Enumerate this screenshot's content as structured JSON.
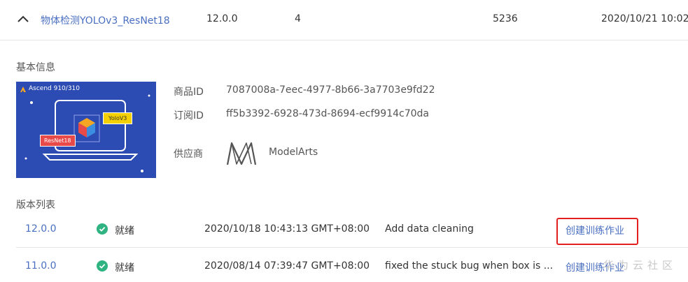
{
  "product_row": {
    "name": "物体检测YOLOv3_ResNet18",
    "version": "12.0.0",
    "count": "4",
    "size": "5236",
    "time": "2020/10/21 10:02:"
  },
  "basic_info": {
    "section_title": "基本信息",
    "image": {
      "chip_label": "Ascend 910/310",
      "tag_yolo": "YoloV3",
      "tag_resnet": "ResNet18"
    },
    "fields": [
      {
        "label": "商品ID",
        "value": "7087008a-7eec-4977-8b66-3a7703e9fd22"
      },
      {
        "label": "订阅ID",
        "value": "ff5b3392-6928-473d-8694-ecf9914c70da"
      },
      {
        "label": "供应商",
        "value": "ModelArts"
      }
    ]
  },
  "versions": {
    "section_title": "版本列表",
    "rows": [
      {
        "version": "12.0.0",
        "status": "就绪",
        "time": "2020/10/18 10:43:13 GMT+08:00",
        "desc": "Add data cleaning",
        "action": "创建训练作业"
      },
      {
        "version": "11.0.0",
        "status": "就绪",
        "time": "2020/08/14 07:39:47 GMT+08:00",
        "desc": "fixed the stuck bug when box is ...",
        "action": "创建训练作业"
      }
    ]
  },
  "watermark": "华为云社区",
  "colors": {
    "link": "#4a6fc1",
    "status_ok": "#2fb380",
    "highlight": "#e31f1f",
    "image_bg": "#2c4bb3"
  },
  "icons": [
    "chevron-up-icon",
    "check-circle-icon",
    "modelarts-logo-icon"
  ]
}
